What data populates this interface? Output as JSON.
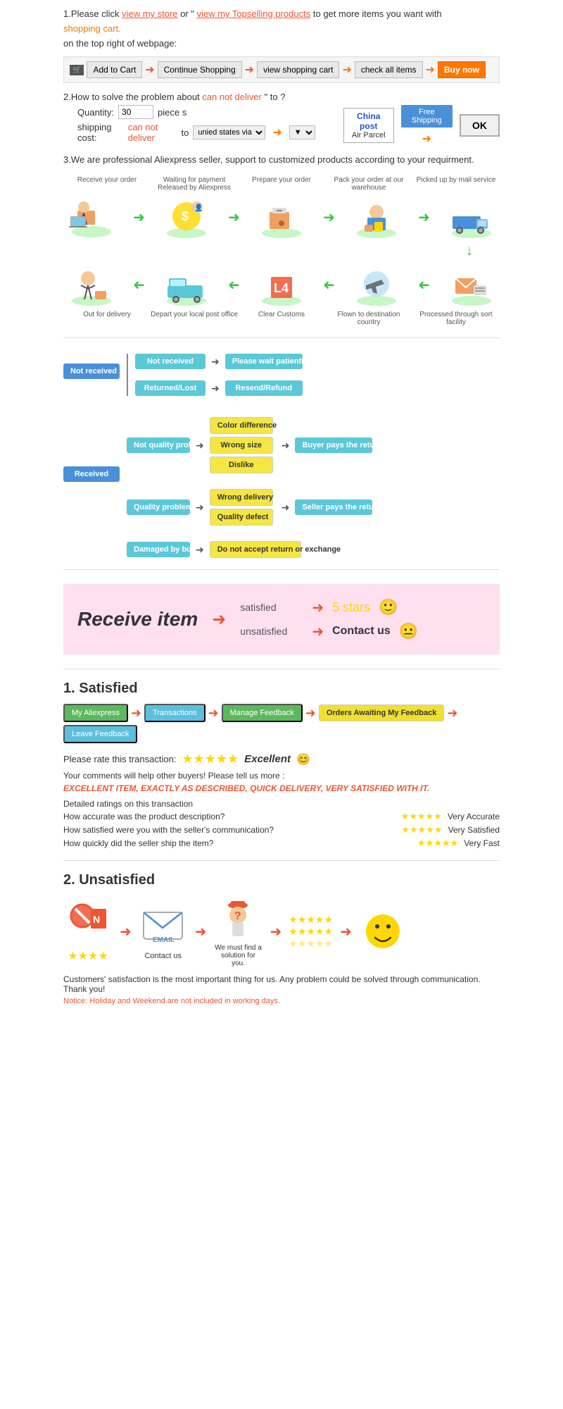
{
  "section1": {
    "text1": "1.Please click ",
    "link1": "view my store",
    "text2": "or ",
    "link2": "view my Topselling products",
    "text3": " to get more items you want with",
    "text4": "shopping cart.",
    "text5": "on the top right of webpage:",
    "steps": [
      {
        "label": "Add to Cart",
        "type": "cart"
      },
      {
        "label": "Continue Shopping",
        "type": "normal"
      },
      {
        "label": "view shopping cart",
        "type": "normal"
      },
      {
        "label": "check all items",
        "type": "normal"
      },
      {
        "label": "Buy now",
        "type": "buy"
      }
    ]
  },
  "section2": {
    "title": "2.How to solve the problem about",
    "problem": "can not deliver",
    "title2": " to",
    "qty_label": "Quantity:",
    "qty_value": "30",
    "qty_unit": "piece s",
    "ship_label": "shipping cost:",
    "ship_problem": "can not deliver",
    "ship_to": " to ",
    "ship_dest": "unied states via",
    "china_post_title": "China post",
    "china_post_sub": "Air Parcel",
    "free_shipping": "Free Shipping",
    "ok": "OK"
  },
  "section3": {
    "text": "3.We are professional Aliexpress seller, support to customized products according to your requirment."
  },
  "process": {
    "steps_top": [
      {
        "label": "Receive your order"
      },
      {
        "label": "Waiting for payment Released by Aliexpress"
      },
      {
        "label": "Prepare your order"
      },
      {
        "label": "Pack your order at our warehouse"
      },
      {
        "label": "Picked up by mail service"
      }
    ],
    "steps_bottom": [
      {
        "label": "Out for delivery"
      },
      {
        "label": "Depart your local post office"
      },
      {
        "label": "Clear Customs"
      },
      {
        "label": "Flown to destination country"
      },
      {
        "label": "Processed through sort facility"
      }
    ]
  },
  "flowchart": {
    "not_received": "Not received",
    "not_received_box": "Not received",
    "please_wait": "Please wait patiently",
    "returned_lost": "Returned/Lost",
    "resend_refund": "Resend/Refund",
    "received": "Received",
    "not_quality": "Not quality problem",
    "color_diff": "Color difference",
    "wrong_size": "Wrong size",
    "dislike": "Dislike",
    "buyer_pays": "Buyer pays the return shipping fee",
    "quality_prob": "Quality problem",
    "wrong_delivery": "Wrong delivery",
    "quality_defect": "Quality defect",
    "seller_pays": "Seller pays the return shipping fee",
    "damaged": "Damaged by buyer",
    "no_return": "Do not accept return or exchange"
  },
  "receive": {
    "title": "Receive item",
    "satisfied_label": "satisfied",
    "unsatisfied_label": "unsatisfied",
    "stars": "5 stars",
    "contact": "Contact us",
    "emoji_happy": "🙂",
    "emoji_neutral": "😐"
  },
  "satisfied": {
    "title": "1. Satisfied",
    "steps": [
      {
        "label": "My Aliexpress",
        "type": "green"
      },
      {
        "label": "Transactions",
        "type": "blue"
      },
      {
        "label": "Manage Feedback",
        "type": "green2"
      },
      {
        "label": "Orders Awaiting My Feedback",
        "type": "yellow2"
      },
      {
        "label": "Leave Feedback",
        "type": "gray"
      }
    ],
    "rate_label": "Please rate this transaction:",
    "excellent": "Excellent",
    "emoji": "😊",
    "comment_label": "Your comments will help other buyers! Please tell us more :",
    "excellent_comment": "EXCELLENT ITEM, EXACTLY AS DESCRIBED, QUICK DELIVERY, VERY SATISFIED WITH IT.",
    "detailed_title": "Detailed ratings on this transaction",
    "ratings": [
      {
        "label": "How accurate was the product description?",
        "value": "Very Accurate"
      },
      {
        "label": "How satisfied were you with the seller's communication?",
        "value": "Very Satisfied"
      },
      {
        "label": "How quickly did the seller ship the item?",
        "value": "Very Fast"
      }
    ]
  },
  "unsatisfied": {
    "title": "2. Unsatisfied",
    "contact_label": "Contact us",
    "solution_label": "We must find a solution for you.",
    "customer_text": "Customers' satisfaction is the most important thing for us. Any problem could be solved through communication. Thank you!",
    "notice": "Notice: Holiday and Weekend are not included in working days."
  }
}
